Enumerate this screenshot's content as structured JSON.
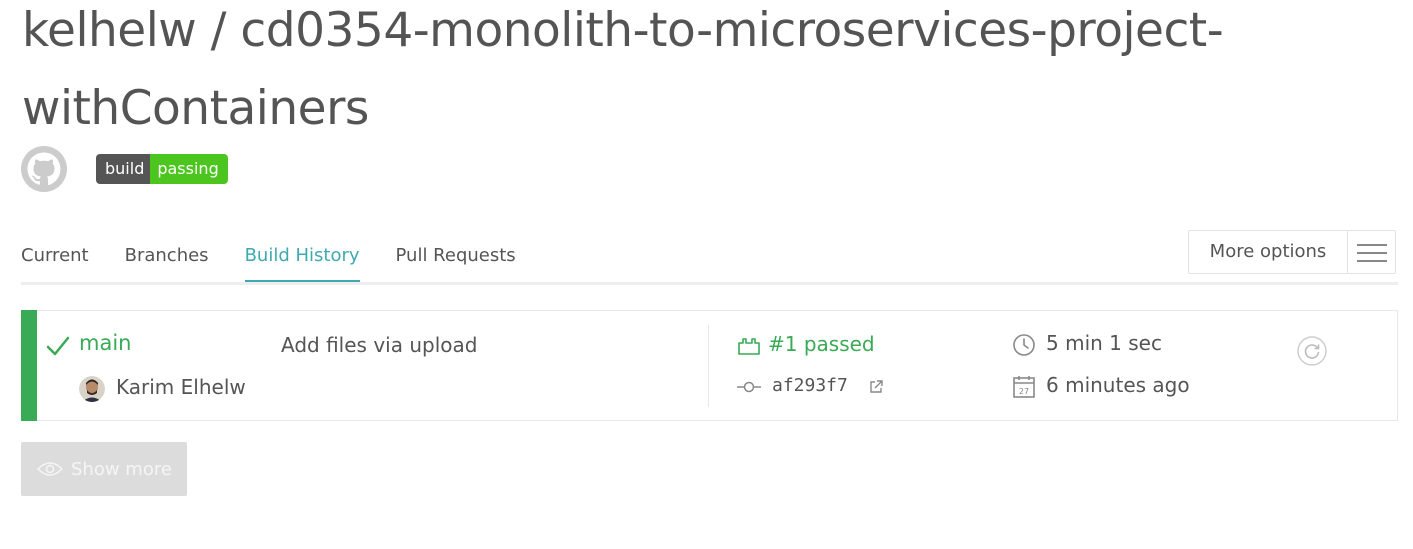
{
  "repo": {
    "title": "kelhelw / cd0354-monolith-to-microservices-project-withContainers"
  },
  "badge": {
    "left_label": "build",
    "right_label": "passing",
    "left_color": "#555555",
    "right_color": "#4cc61e"
  },
  "tabs": [
    {
      "label": "Current"
    },
    {
      "label": "Branches"
    },
    {
      "label": "Build History"
    },
    {
      "label": "Pull Requests"
    }
  ],
  "active_tab": "Build History",
  "more_options": {
    "label": "More options",
    "menu_icon": "hamburger-icon"
  },
  "build": {
    "status": "passed",
    "status_color": "#39aa56",
    "branch": "main",
    "commit_message": "Add files via upload",
    "author": "Karim Elhelw",
    "build_number": "#1 passed",
    "commit_sha": "af293f7",
    "duration": "5 min 1 sec",
    "finished": "6 minutes ago"
  },
  "show_more": {
    "label": "Show more"
  },
  "colors": {
    "accent": "#3eaaaf",
    "passed": "#39aa56"
  }
}
